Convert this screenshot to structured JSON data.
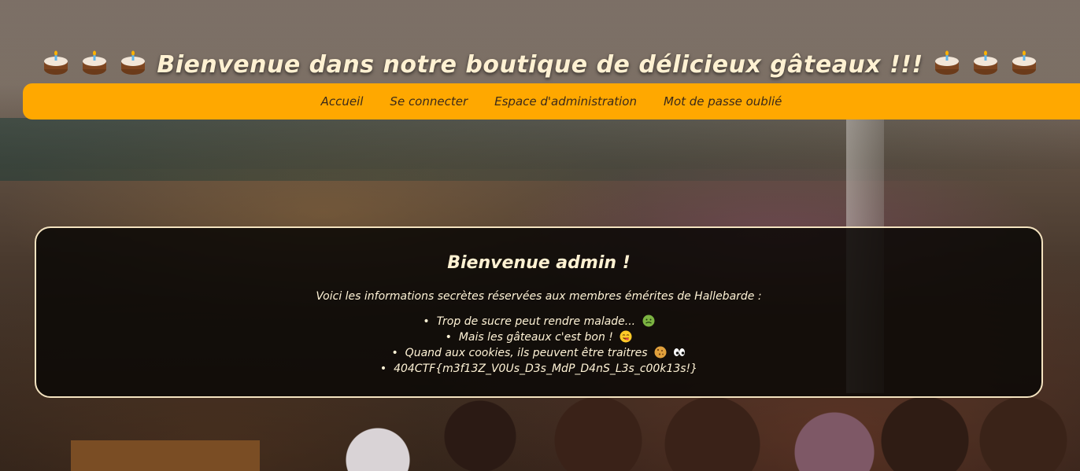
{
  "header": {
    "title": "Bienvenue dans notre boutique de délicieux gâteaux !!!",
    "left_icons": [
      "cake-icon",
      "cake-icon",
      "cake-icon"
    ],
    "right_icons": [
      "cake-icon",
      "cake-icon",
      "cake-icon"
    ]
  },
  "nav": {
    "items": [
      {
        "label": "Accueil"
      },
      {
        "label": "Se connecter"
      },
      {
        "label": "Espace d'administration"
      },
      {
        "label": "Mot de passe oublié"
      }
    ],
    "bar_color": "#ffa800"
  },
  "panel": {
    "title": "Bienvenue admin !",
    "intro": "Voici les informations secrètes réservées aux membres émérites de Hallebarde :",
    "items": [
      {
        "text": "Trop de sucre peut rendre malade...",
        "icon": "nauseated-face-icon"
      },
      {
        "text": "Mais les gâteaux c'est bon !",
        "icon": "yum-face-icon"
      },
      {
        "text": "Quand aux cookies, ils peuvent être traitres",
        "icon": "cookie-eyes-icon"
      },
      {
        "text": "404CTF{m3f13Z_V0Us_D3s_MdP_D4nS_L3s_c00k13s!}",
        "icon": ""
      }
    ],
    "border_color": "#f4e3c0"
  }
}
